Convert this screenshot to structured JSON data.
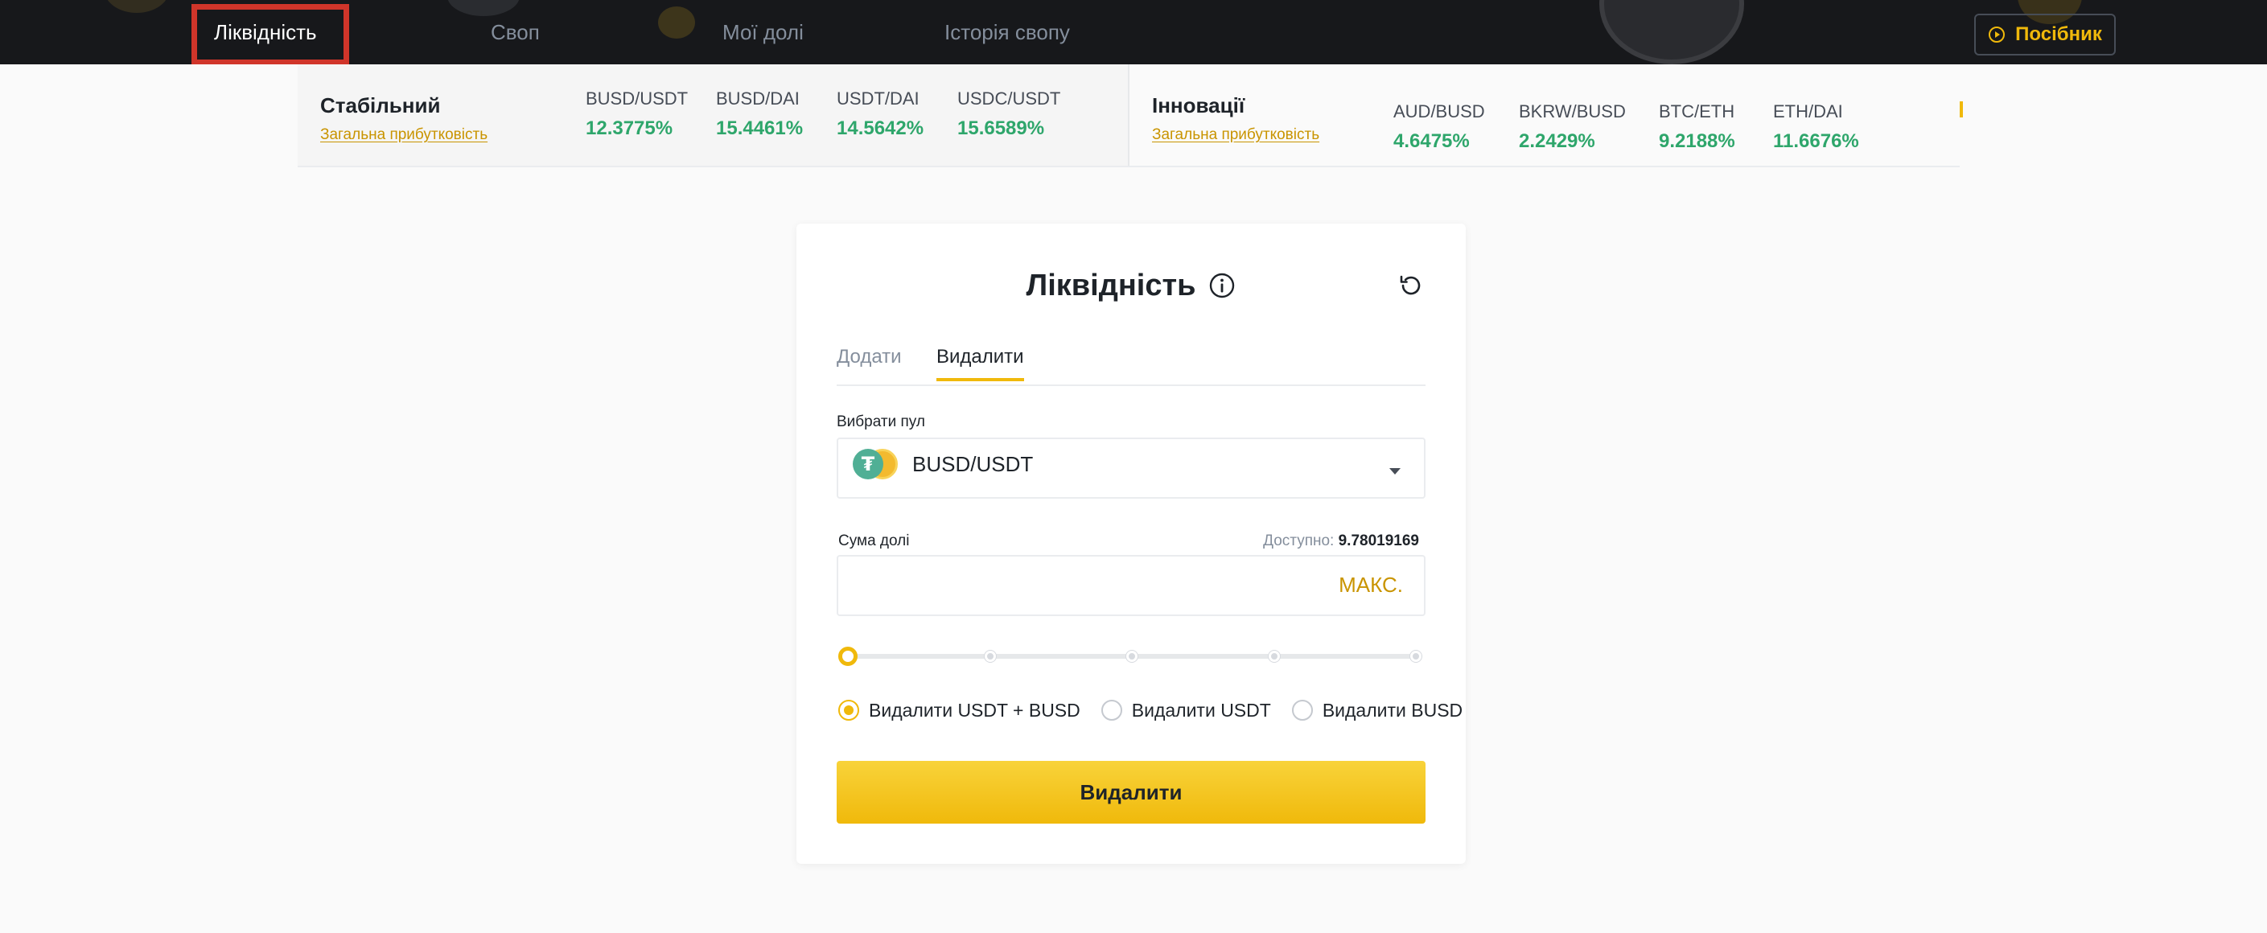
{
  "nav": {
    "items": [
      {
        "label": "Ліквідність",
        "active": true
      },
      {
        "label": "Своп",
        "active": false
      },
      {
        "label": "Мої долі",
        "active": false
      },
      {
        "label": "Історія свопу",
        "active": false
      }
    ],
    "guide_label": "Посібник",
    "guide_icon": "play-circle-icon"
  },
  "ticker": {
    "stable": {
      "title": "Стабільний",
      "link": "Загальна прибутковість",
      "pairs": [
        {
          "name": "BUSD/USDT",
          "apy": "12.3775%"
        },
        {
          "name": "BUSD/DAI",
          "apy": "15.4461%"
        },
        {
          "name": "USDT/DAI",
          "apy": "14.5642%"
        },
        {
          "name": "USDC/USDT",
          "apy": "15.6589%"
        }
      ]
    },
    "innovation": {
      "title": "Інновації",
      "link": "Загальна прибутковість",
      "pairs": [
        {
          "name": "AUD/BUSD",
          "apy": "4.6475%"
        },
        {
          "name": "BKRW/BUSD",
          "apy": "2.2429%"
        },
        {
          "name": "BTC/ETH",
          "apy": "9.2188%"
        },
        {
          "name": "ETH/DAI",
          "apy": "11.6676%"
        }
      ]
    }
  },
  "card": {
    "title": "Ліквідність",
    "tabs": [
      {
        "label": "Додати",
        "active": false
      },
      {
        "label": "Видалити",
        "active": true
      }
    ],
    "pool_label": "Вибрати пул",
    "pool_value": "BUSD/USDT",
    "pool_coin_glyph": "₮",
    "amount_label": "Сума долі",
    "available_label": "Доступно:",
    "available_value": "9.78019169",
    "amount_value": "",
    "max_label": "МАКС.",
    "slider_percent": 0,
    "slider_steps": [
      0,
      25,
      50,
      75,
      100
    ],
    "remove_options": [
      {
        "label": "Видалити USDT + BUSD",
        "checked": true
      },
      {
        "label": "Видалити USDT",
        "checked": false
      },
      {
        "label": "Видалити BUSD",
        "checked": false
      }
    ],
    "submit_label": "Видалити"
  },
  "colors": {
    "brand_yellow": "#f0b90b",
    "link_gold": "#c99400",
    "apy_green": "#2ea66b",
    "nav_bg": "#17181b",
    "highlight_red": "#d0352a"
  }
}
